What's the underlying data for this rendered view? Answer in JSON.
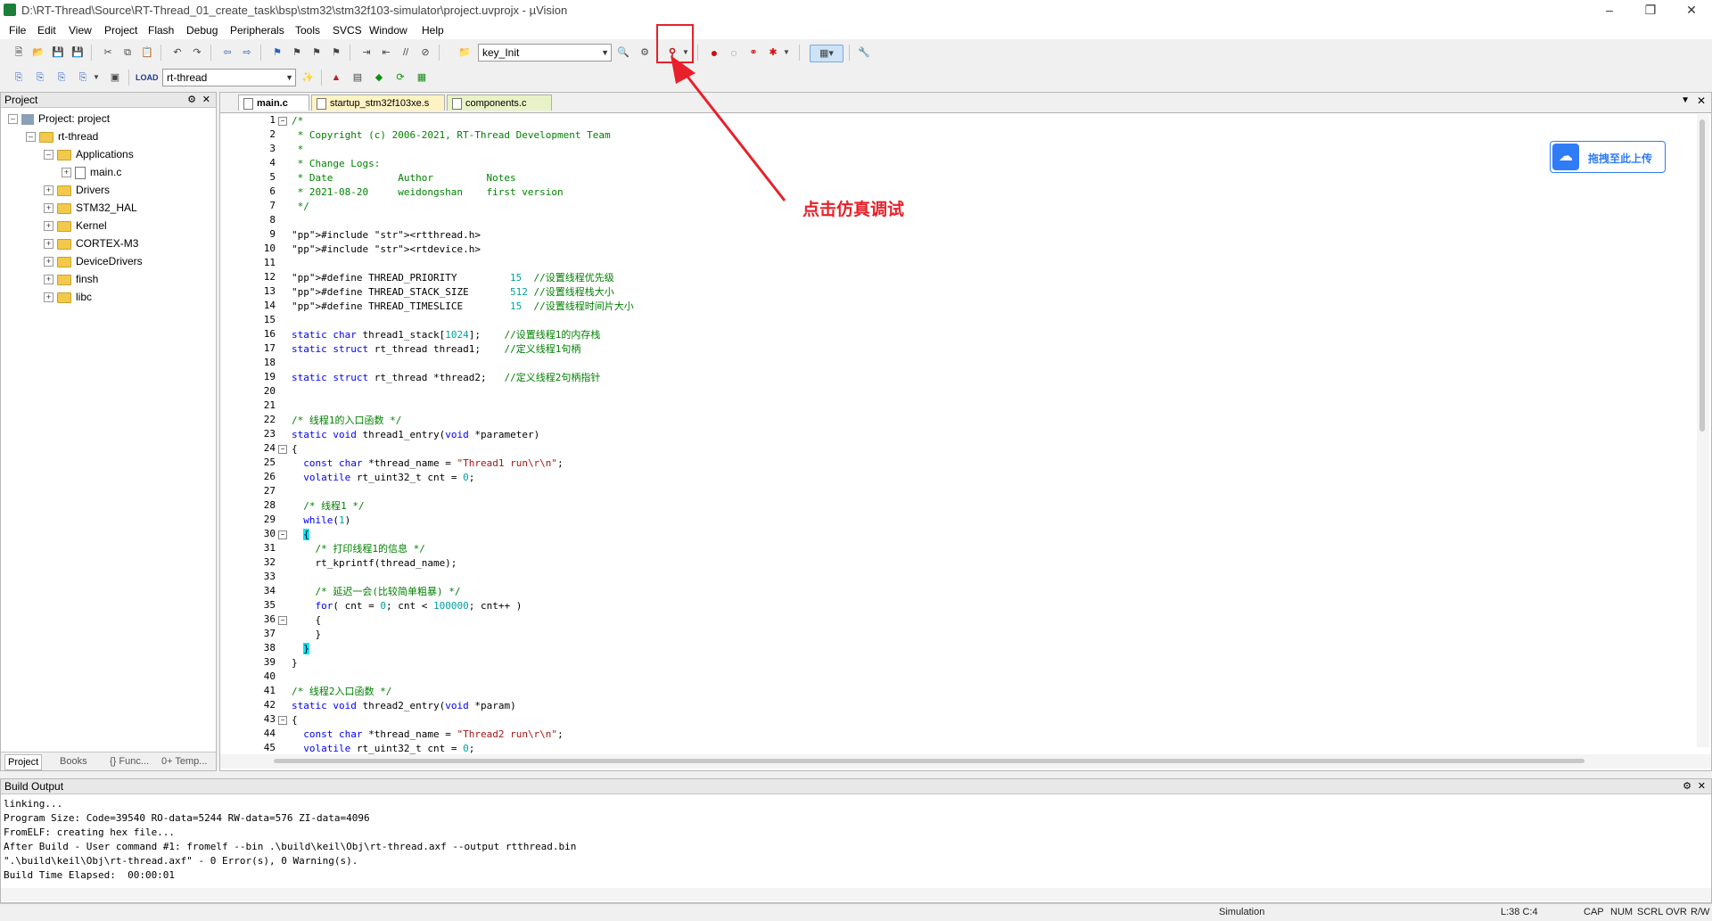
{
  "window": {
    "title": "D:\\RT-Thread\\Source\\RT-Thread_01_create_task\\bsp\\stm32\\stm32f103-simulator\\project.uvprojx - µVision"
  },
  "menu": [
    "File",
    "Edit",
    "View",
    "Project",
    "Flash",
    "Debug",
    "Peripherals",
    "Tools",
    "SVCS",
    "Window",
    "Help"
  ],
  "toolbar": {
    "function_combo": "key_Init",
    "target_combo": "rt-thread"
  },
  "annotation": {
    "text": "点击仿真调试",
    "color": "#e8202a"
  },
  "cloud_button": {
    "label": "拖拽至此上传",
    "color": "#2f7cf6"
  },
  "project_pane": {
    "header": "Project",
    "tree": [
      {
        "label": "Project: project"
      },
      {
        "label": "rt-thread"
      },
      {
        "label": "Applications"
      },
      {
        "label": "main.c"
      },
      {
        "label": "Drivers"
      },
      {
        "label": "STM32_HAL"
      },
      {
        "label": "Kernel"
      },
      {
        "label": "CORTEX-M3"
      },
      {
        "label": "DeviceDrivers"
      },
      {
        "label": "finsh"
      },
      {
        "label": "libc"
      }
    ],
    "bottom_tabs": [
      "Project",
      "Books",
      "{} Func...",
      "0+ Temp..."
    ]
  },
  "editor": {
    "tabs": [
      "main.c",
      "startup_stm32f103xe.s",
      "components.c"
    ],
    "line_numbers": [
      "1",
      "2",
      "3",
      "4",
      "5",
      "6",
      "7",
      "8",
      "9",
      "10",
      "11",
      "12",
      "13",
      "14",
      "15",
      "16",
      "17",
      "18",
      "19",
      "20",
      "21",
      "22",
      "23",
      "24",
      "25",
      "26",
      "27",
      "28",
      "29",
      "30",
      "31",
      "32",
      "33",
      "34",
      "35",
      "36",
      "37",
      "38",
      "39",
      "40",
      "41",
      "42",
      "43",
      "44",
      "45"
    ],
    "lines": [
      "/*",
      " * Copyright (c) 2006-2021, RT-Thread Development Team",
      " *",
      " * Change Logs:",
      " * Date           Author         Notes",
      " * 2021-08-20     weidongshan    first version",
      " */",
      "",
      "#include <rtthread.h>",
      "#include <rtdevice.h>",
      "",
      "#define THREAD_PRIORITY         15  //设置线程优先级",
      "#define THREAD_STACK_SIZE       512 //设置线程栈大小",
      "#define THREAD_TIMESLICE        15  //设置线程时间片大小",
      "",
      "static char thread1_stack[1024];    //设置线程1的内存栈",
      "static struct rt_thread thread1;    //定义线程1句柄",
      "",
      "static struct rt_thread *thread2;   //定义线程2句柄指针",
      "",
      "",
      "/* 线程1的入口函数 */",
      "static void thread1_entry(void *parameter)",
      "{",
      "  const char *thread_name = \"Thread1 run\\r\\n\";",
      "  volatile rt_uint32_t cnt = 0;",
      "",
      "  /* 线程1 */",
      "  while(1)",
      "  {",
      "    /* 打印线程1的信息 */",
      "    rt_kprintf(thread_name);",
      "",
      "    /* 延迟一会(比较简单粗暴) */",
      "    for( cnt = 0; cnt < 100000; cnt++ )",
      "    {",
      "    }",
      "  }",
      "}",
      "",
      "/* 线程2入口函数 */",
      "static void thread2_entry(void *param)",
      "{",
      "  const char *thread_name = \"Thread2 run\\r\\n\";",
      "  volatile rt_uint32_t cnt = 0;"
    ]
  },
  "build_output": {
    "header": "Build Output",
    "lines": [
      "linking...",
      "Program Size: Code=39540 RO-data=5244 RW-data=576 ZI-data=4096",
      "FromELF: creating hex file...",
      "After Build - User command #1: fromelf --bin .\\build\\keil\\Obj\\rt-thread.axf --output rtthread.bin",
      "\".\\build\\keil\\Obj\\rt-thread.axf\" - 0 Error(s), 0 Warning(s).",
      "Build Time Elapsed:  00:00:01"
    ]
  },
  "status": {
    "mode": "Simulation",
    "position": "L:38 C:4",
    "cap": "CAP",
    "num": "NUM",
    "scrl": "SCRL",
    "ovr": "OVR",
    "rw": "R/W"
  }
}
